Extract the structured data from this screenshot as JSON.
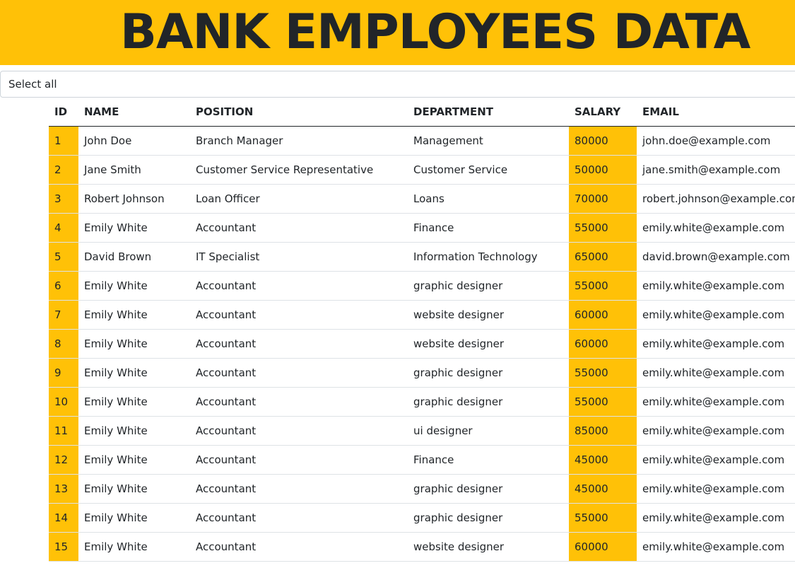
{
  "header": {
    "title": "BANK EMPLOYEES DATA",
    "accent_color": "#FFC107"
  },
  "select": {
    "selected": "Select all"
  },
  "table": {
    "columns": [
      "ID",
      "NAME",
      "POSITION",
      "DEPARTMENT",
      "SALARY",
      "EMAIL"
    ],
    "rows": [
      [
        "1",
        "John Doe",
        "Branch Manager",
        "Management",
        "80000",
        "john.doe@example.com"
      ],
      [
        "2",
        "Jane Smith",
        "Customer Service Representative",
        "Customer Service",
        "50000",
        "jane.smith@example.com"
      ],
      [
        "3",
        "Robert Johnson",
        "Loan Officer",
        "Loans",
        "70000",
        "robert.johnson@example.com"
      ],
      [
        "4",
        "Emily White",
        "Accountant",
        "Finance",
        "55000",
        "emily.white@example.com"
      ],
      [
        "5",
        "David Brown",
        "IT Specialist",
        "Information Technology",
        "65000",
        "david.brown@example.com"
      ],
      [
        "6",
        "Emily White",
        "Accountant",
        "graphic designer",
        "55000",
        "emily.white@example.com"
      ],
      [
        "7",
        "Emily White",
        "Accountant",
        "website designer",
        "60000",
        "emily.white@example.com"
      ],
      [
        "8",
        "Emily White",
        "Accountant",
        "website designer",
        "60000",
        "emily.white@example.com"
      ],
      [
        "9",
        "Emily White",
        "Accountant",
        "graphic designer",
        "55000",
        "emily.white@example.com"
      ],
      [
        "10",
        "Emily White",
        "Accountant",
        "graphic designer",
        "55000",
        "emily.white@example.com"
      ],
      [
        "11",
        "Emily White",
        "Accountant",
        "ui designer",
        "85000",
        "emily.white@example.com"
      ],
      [
        "12",
        "Emily White",
        "Accountant",
        "Finance",
        "45000",
        "emily.white@example.com"
      ],
      [
        "13",
        "Emily White",
        "Accountant",
        "graphic designer",
        "45000",
        "emily.white@example.com"
      ],
      [
        "14",
        "Emily White",
        "Accountant",
        "graphic designer",
        "55000",
        "emily.white@example.com"
      ],
      [
        "15",
        "Emily White",
        "Accountant",
        "website designer",
        "60000",
        "emily.white@example.com"
      ]
    ]
  }
}
